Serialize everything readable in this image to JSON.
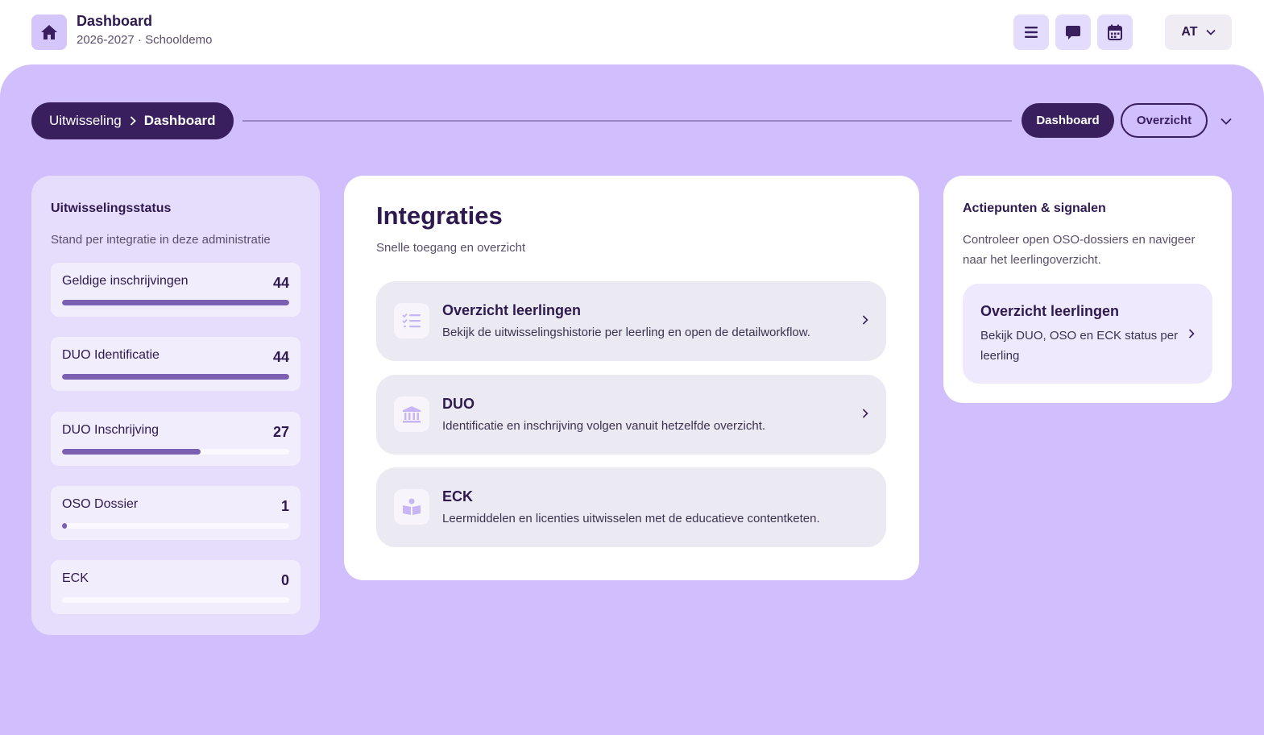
{
  "header": {
    "title": "Dashboard",
    "subtitle": "2026-2027 · Schooldemo",
    "icons": [
      "home-icon",
      "menu-icon",
      "chat-icon",
      "calendar-icon"
    ],
    "user_initials": "AT"
  },
  "breadcrumb": {
    "parent": "Uitwisseling",
    "current": "Dashboard"
  },
  "tabs": {
    "active": "Dashboard",
    "other": "Overzicht"
  },
  "status": {
    "title": "Uitwisselingsstatus",
    "subtitle": "Stand per integratie in deze administratie",
    "items": [
      {
        "label": "Geldige inschrijvingen",
        "value": "44",
        "fraction": 1.0
      },
      {
        "label": "DUO Identificatie",
        "value": "44",
        "fraction": 1.0
      },
      {
        "label": "DUO Inschrijving",
        "value": "27",
        "fraction": 0.61
      },
      {
        "label": "OSO Dossier",
        "value": "1",
        "fraction": 0.023
      },
      {
        "label": "ECK",
        "value": "0",
        "fraction": 0
      }
    ]
  },
  "integraties": {
    "title": "Integraties",
    "subtitle": "Snelle toegang en overzicht",
    "items": [
      {
        "name": "Overzicht leerlingen",
        "desc": "Bekijk de uitwisselingshistorie per leerling en open de detailworkflow.",
        "icon": "list-check-icon"
      },
      {
        "name": "DUO",
        "desc": "Identificatie en inschrijving volgen vanuit hetzelfde overzicht.",
        "icon": "institution-icon"
      },
      {
        "name": "ECK",
        "desc": "Leermiddelen en licenties uitwisselen met de educatieve contentketen.",
        "icon": "book-reader-icon"
      }
    ]
  },
  "actiepunten": {
    "title": "Actiepunten & signalen",
    "subtitle": "Controleer open OSO-dossiers en navigeer naar het leerlingoverzicht.",
    "item": {
      "name": "Overzicht leerlingen",
      "desc": "Bekijk DUO, OSO en ECK status per leerling"
    }
  },
  "colors": {
    "accent_dark": "#3a1f5e",
    "background": "#d0bffc",
    "progress_fill": "#7b5fb0"
  }
}
